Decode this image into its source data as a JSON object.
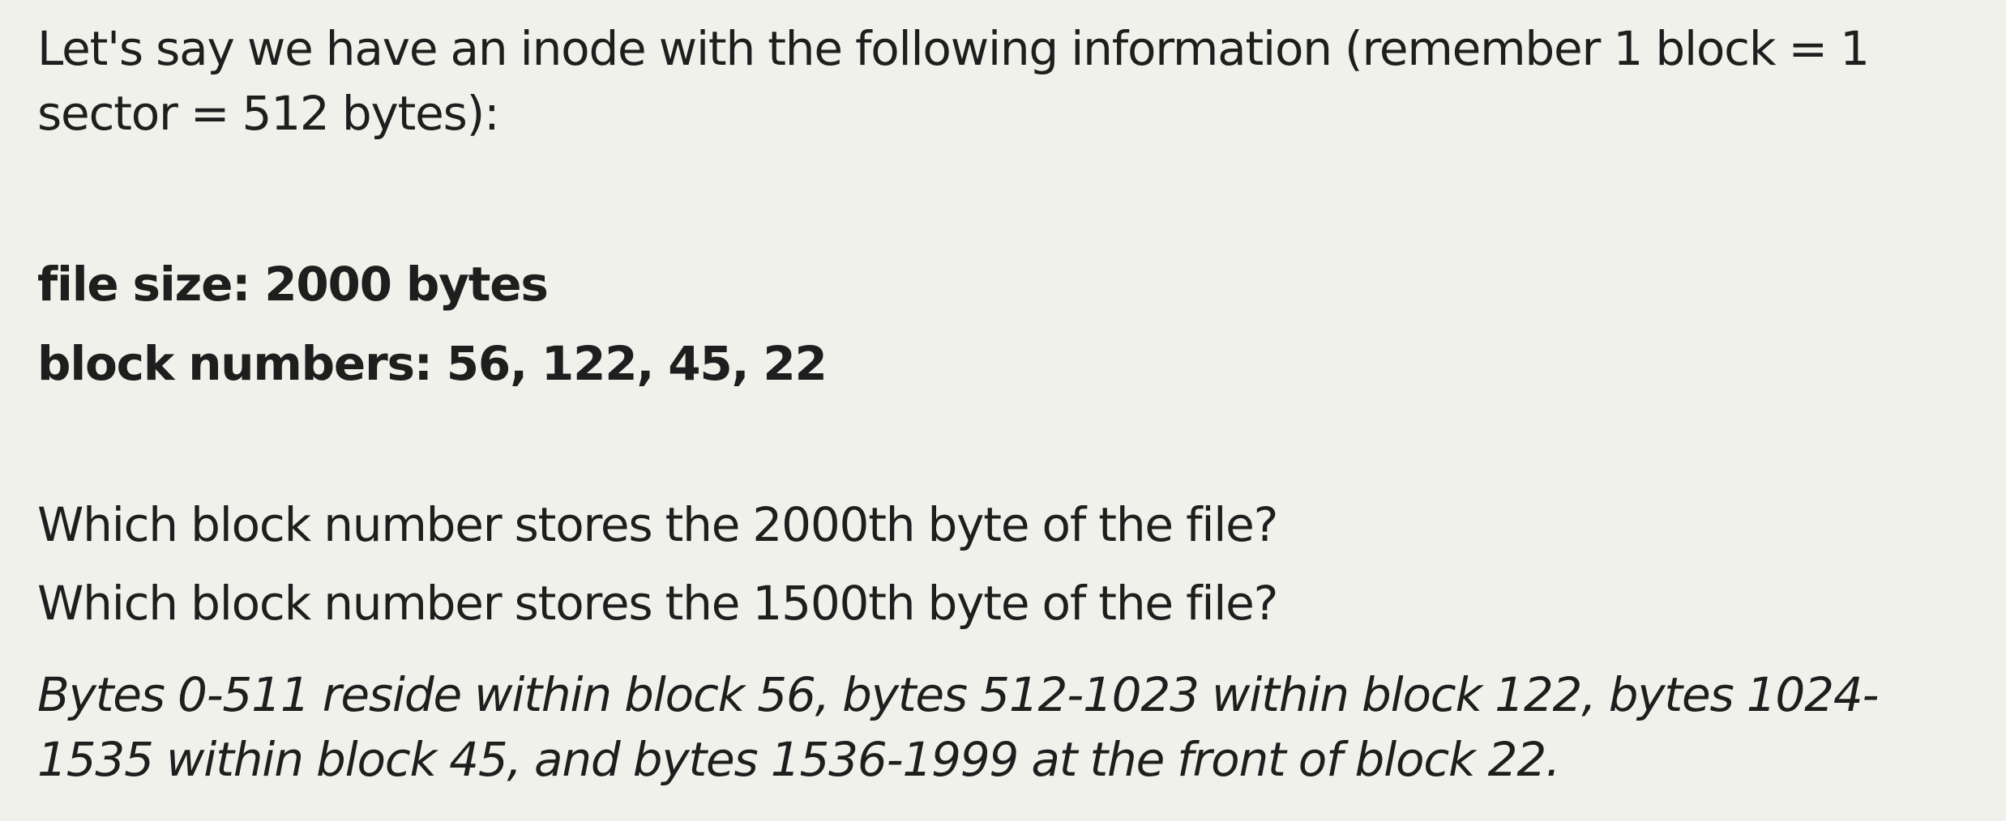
{
  "intro": "Let's say we have an inode with the following information (remember 1 block = 1 sector = 512 bytes):",
  "facts": {
    "file_size": "file size: 2000 bytes",
    "block_numbers": "block numbers: 56, 122, 45, 22"
  },
  "questions": [
    "Which block number stores the 2000th byte of the file?",
    "Which block number stores the 1500th byte of the file?"
  ],
  "answer": "Bytes 0-511 reside within block 56, bytes 512-1023 within block 122, bytes 1024-1535 within block 45, and bytes 1536-1999 at the front of block 22."
}
